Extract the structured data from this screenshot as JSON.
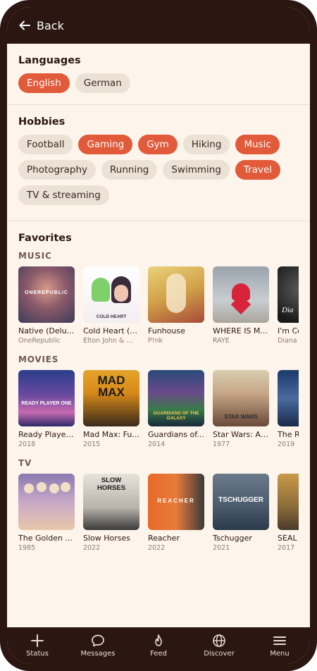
{
  "header": {
    "back_label": "Back"
  },
  "languages": {
    "title": "Languages",
    "items": [
      {
        "label": "English",
        "selected": true
      },
      {
        "label": "German",
        "selected": false
      }
    ]
  },
  "hobbies": {
    "title": "Hobbies",
    "items": [
      {
        "label": "Football",
        "selected": false
      },
      {
        "label": "Gaming",
        "selected": true
      },
      {
        "label": "Gym",
        "selected": true
      },
      {
        "label": "Hiking",
        "selected": false
      },
      {
        "label": "Music",
        "selected": true
      },
      {
        "label": "Photography",
        "selected": false
      },
      {
        "label": "Running",
        "selected": false
      },
      {
        "label": "Swimming",
        "selected": false
      },
      {
        "label": "Travel",
        "selected": true
      },
      {
        "label": "TV & streaming",
        "selected": false
      }
    ]
  },
  "favorites": {
    "title": "Favorites",
    "music": {
      "label": "MUSIC",
      "items": [
        {
          "title": "Native (Delu...",
          "sub": "OneRepublic",
          "cover_text": "ONEREPUBLIC"
        },
        {
          "title": "Cold Heart (...",
          "sub": "Elton John & ...",
          "cover_text": "COLD HEART"
        },
        {
          "title": "Funhouse",
          "sub": "P!nk",
          "cover_text": ""
        },
        {
          "title": "WHERE IS M...",
          "sub": "RAYE",
          "cover_text": ""
        },
        {
          "title": "I'm Co",
          "sub": "Diana",
          "cover_text": "Dia"
        }
      ]
    },
    "movies": {
      "label": "MOVIES",
      "items": [
        {
          "title": "Ready Player...",
          "sub": "2018",
          "cover_text": "READY PLAYER ONE"
        },
        {
          "title": "Mad Max: Fu...",
          "sub": "2015",
          "cover_text": "MAD MAX"
        },
        {
          "title": "Guardians of...",
          "sub": "2014",
          "cover_text": "GUARDIANS OF THE GALAXY"
        },
        {
          "title": "Star Wars: A ...",
          "sub": "1977",
          "cover_text": "STAR WARS"
        },
        {
          "title": "The R",
          "sub": "2019",
          "cover_text": ""
        }
      ]
    },
    "tv": {
      "label": "TV",
      "items": [
        {
          "title": "The Golden ...",
          "sub": "1985",
          "cover_text": ""
        },
        {
          "title": "Slow Horses",
          "sub": "2022",
          "cover_text": "SLOW HORSES"
        },
        {
          "title": "Reacher",
          "sub": "2022",
          "cover_text": "REACHER"
        },
        {
          "title": "Tschugger",
          "sub": "2021",
          "cover_text": "TSCHUGGER"
        },
        {
          "title": "SEAL",
          "sub": "2017",
          "cover_text": ""
        }
      ]
    }
  },
  "nav": [
    {
      "label": "Status",
      "icon": "plus-icon"
    },
    {
      "label": "Messages",
      "icon": "chat-icon"
    },
    {
      "label": "Feed",
      "icon": "flame-icon"
    },
    {
      "label": "Discover",
      "icon": "globe-icon"
    },
    {
      "label": "Menu",
      "icon": "menu-icon"
    }
  ],
  "colors": {
    "accent": "#e15a3a",
    "bar": "#2b1612",
    "background": "#fdf5ec",
    "chip": "#ebe1d5"
  }
}
